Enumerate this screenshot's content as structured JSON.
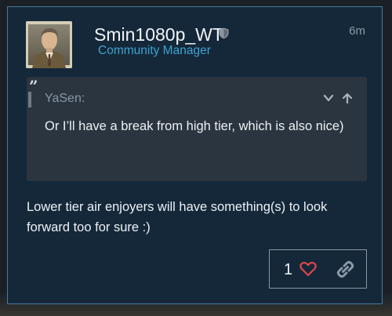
{
  "post": {
    "username": "Smin1080p_WT",
    "role": "Community Manager",
    "time": "6m",
    "badge_icon": "shield-icon",
    "quote": {
      "author": "YaSen:",
      "text": "Or I’ll have a break from high tier, which is also nice)",
      "icons": [
        "quote-icon",
        "chevron-down-icon",
        "arrow-up-icon"
      ]
    },
    "body": "Lower tier air enjoyers will have something(s) to look forward too for sure :)",
    "actions": {
      "like_count": "1",
      "icons": [
        "heart-icon",
        "link-icon"
      ]
    }
  },
  "colors": {
    "card_bg": "#14283a",
    "card_border": "#4a7a9b",
    "role": "#3fa2cf",
    "quote_bg": "#2a3540",
    "heart": "#e0454a",
    "link": "#8a9aa8"
  }
}
